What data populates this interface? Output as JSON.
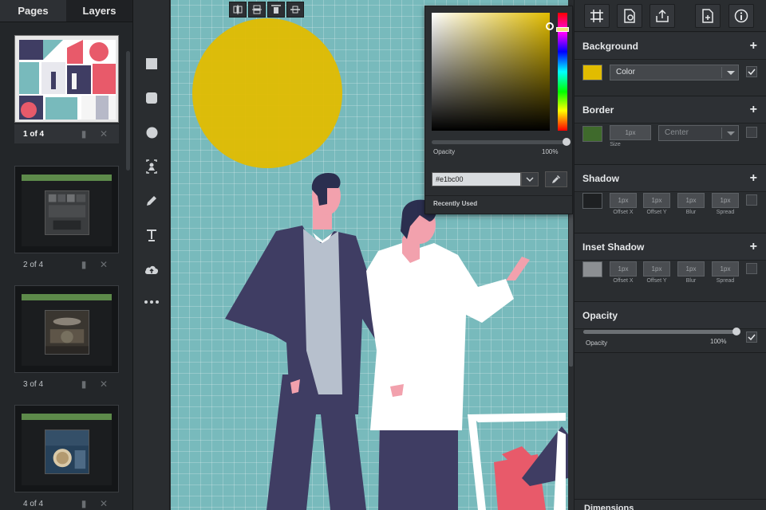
{
  "tabs": {
    "pages": "Pages",
    "layers": "Layers"
  },
  "pages": [
    {
      "label": "1 of 4"
    },
    {
      "label": "2 of 4"
    },
    {
      "label": "3 of 4"
    },
    {
      "label": "4 of 4"
    }
  ],
  "tools": [
    "square-icon",
    "rounded-square-icon",
    "circle-icon",
    "image-upload-icon",
    "pencil-icon",
    "text-icon",
    "cloud-upload-icon",
    "more-icon"
  ],
  "top_toolbar": [
    "grid-icon",
    "page-settings-icon",
    "share-icon",
    "add-page-icon",
    "info-icon"
  ],
  "color_picker": {
    "opacity_label": "Opacity",
    "opacity_value": "100%",
    "opacity_level": 1.0,
    "hex": "#e1bc00",
    "recently_used": "Recently Used",
    "selected_color": "#e1bc00"
  },
  "background": {
    "title": "Background",
    "swatch_color": "#e1bc00",
    "type": "Color"
  },
  "border": {
    "title": "Border",
    "swatch_color": "#3f6a2c",
    "size": "1px",
    "size_label": "Size",
    "position": "Center"
  },
  "shadow": {
    "title": "Shadow",
    "swatch_color": "#1e2022",
    "fields": [
      {
        "value": "1px",
        "label": "Offset X"
      },
      {
        "value": "1px",
        "label": "Offset Y"
      },
      {
        "value": "1px",
        "label": "Blur"
      },
      {
        "value": "1px",
        "label": "Spread"
      }
    ]
  },
  "inset_shadow": {
    "title": "Inset Shadow",
    "swatch_color": "#8c8f92",
    "fields": [
      {
        "value": "1px",
        "label": "Offset X"
      },
      {
        "value": "1px",
        "label": "Offset Y"
      },
      {
        "value": "1px",
        "label": "Blur"
      },
      {
        "value": "1px",
        "label": "Spread"
      }
    ]
  },
  "opacity": {
    "title": "Opacity",
    "label": "Opacity",
    "value": "100%",
    "level": 1.0
  },
  "dimensions": {
    "title": "Dimensions"
  },
  "colors": {
    "canvas": "#78babc",
    "sun": "#e1bc00",
    "navy": "#3f3d63",
    "pink": "#f2a1ad"
  }
}
